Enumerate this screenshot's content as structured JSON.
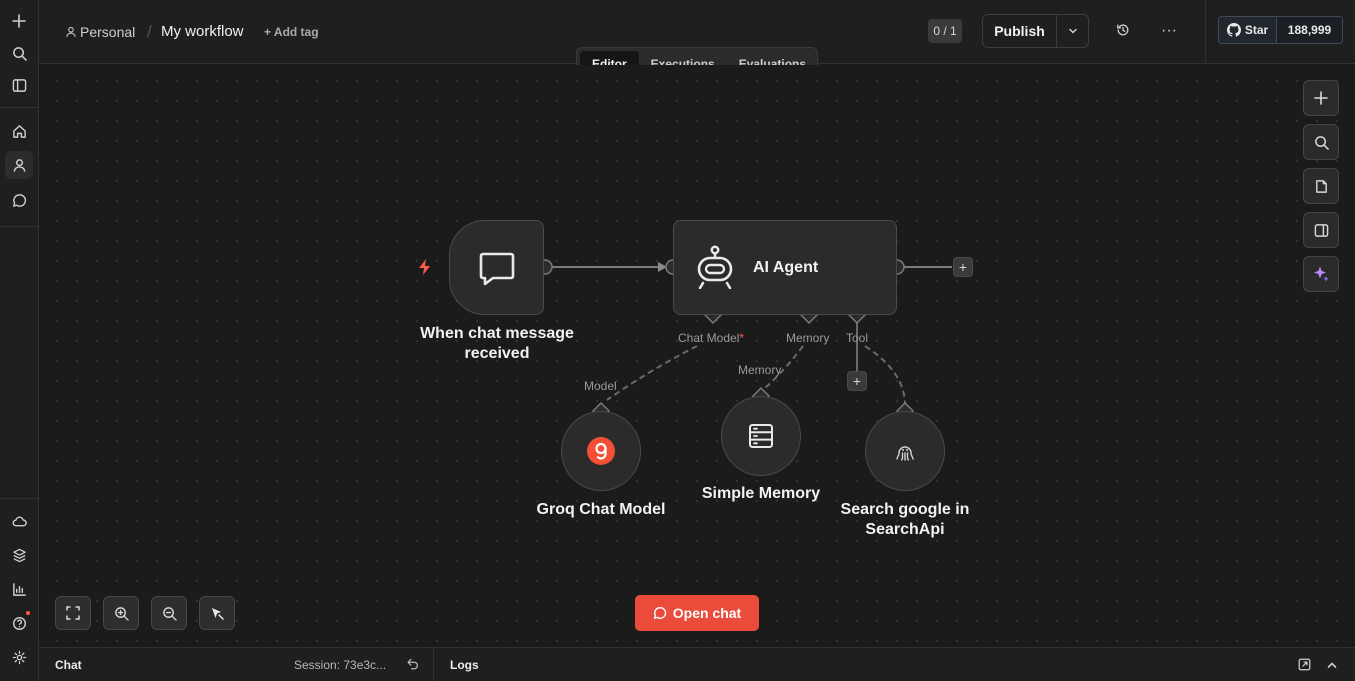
{
  "breadcrumb": {
    "project": "Personal",
    "workflow_name": "My workflow",
    "add_tag": "+ Add tag"
  },
  "header": {
    "counter": "0 / 1",
    "publish_label": "Publish",
    "github_star_label": "Star",
    "github_star_count": "188,999"
  },
  "tabs": [
    {
      "label": "Editor",
      "active": true
    },
    {
      "label": "Executions",
      "active": false
    },
    {
      "label": "Evaluations",
      "active": false
    }
  ],
  "nodes": {
    "trigger": {
      "title": "When chat message received",
      "icon": "chat-bubble-icon"
    },
    "agent": {
      "title": "AI Agent",
      "icon": "robot-icon"
    },
    "groq": {
      "title": "Groq Chat Model",
      "icon": "groq-logo-icon"
    },
    "memory": {
      "title": "Simple Memory",
      "icon": "database-icon"
    },
    "search": {
      "title": "Search google in SearchApi",
      "icon": "searchapi-icon"
    }
  },
  "connectors": {
    "chat_model": "Chat Model",
    "chat_model_required": "*",
    "memory": "Memory",
    "tool": "Tool",
    "model": "Model",
    "memory_sub": "Memory"
  },
  "actions": {
    "open_chat": "Open chat"
  },
  "bottom": {
    "chat_label": "Chat",
    "session": "Session: 73e3c...",
    "logs_label": "Logs"
  },
  "colors": {
    "accent": "#ea4b3a",
    "canvas_bg": "#1b1b1b",
    "node_bg": "#2b2b2b",
    "groq_brand": "#f55036"
  }
}
